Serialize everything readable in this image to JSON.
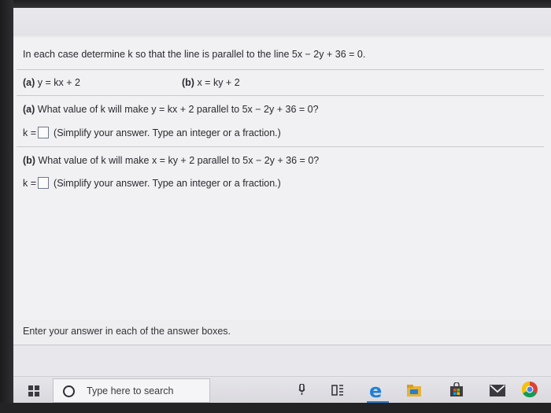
{
  "problem": {
    "intro": "In each case determine k so that the line is parallel to the line 5x − 2y + 36 = 0.",
    "part_a_label": "(a)",
    "part_a_eq": "y = kx + 2",
    "part_b_label": "(b)",
    "part_b_eq": "x = ky + 2",
    "question_a_label": "(a)",
    "question_a_text": "What value of k will make y = kx + 2 parallel to 5x − 2y + 36 = 0?",
    "answer_a_prefix": "k =",
    "answer_a_value": "",
    "answer_a_hint": "(Simplify your answer. Type an integer or a fraction.)",
    "question_b_label": "(b)",
    "question_b_text": "What value of k will make x = ky + 2 parallel to 5x − 2y + 36 = 0?",
    "answer_b_prefix": "k =",
    "answer_b_value": "",
    "answer_b_hint": "(Simplify your answer. Type an integer or a fraction.)"
  },
  "footer": {
    "message": "Enter your answer in each of the answer boxes."
  },
  "taskbar": {
    "search_placeholder": "Type here to search",
    "icons": [
      "windows-start-icon",
      "search-icon",
      "microphone-icon",
      "task-view-icon",
      "edge-icon",
      "file-explorer-icon",
      "store-icon",
      "mail-icon",
      "chrome-icon"
    ],
    "colors": {
      "edge": "#1f7fd6",
      "chrome_red": "#db4437",
      "chrome_yellow": "#f4c20d",
      "chrome_green": "#0f9d58",
      "chrome_blue": "#4285f4"
    }
  }
}
